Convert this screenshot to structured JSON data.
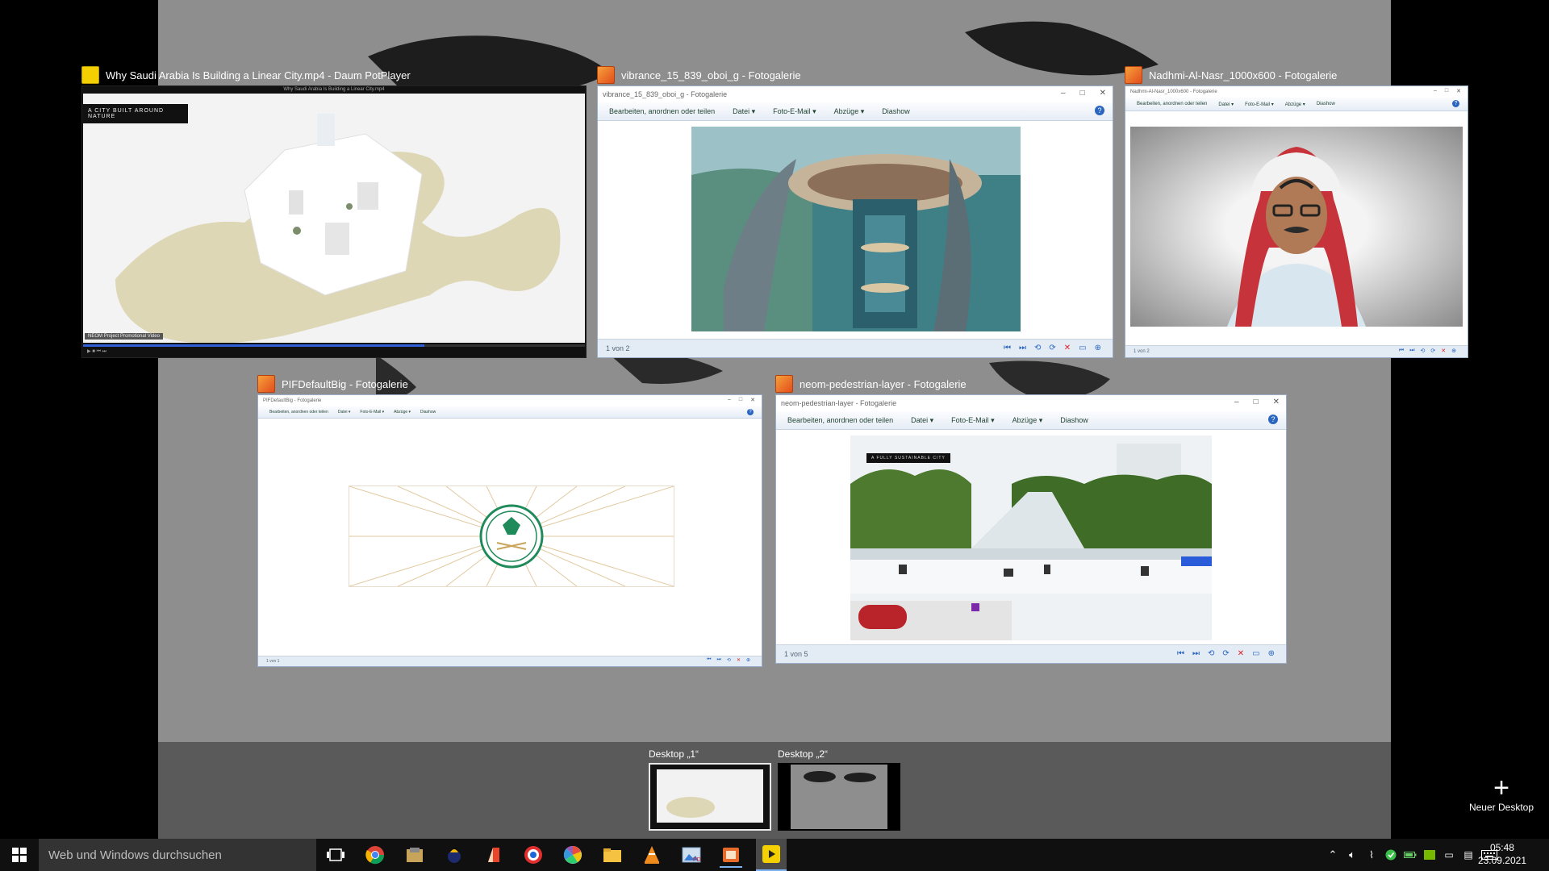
{
  "windows": [
    {
      "title": "Why Saudi Arabia Is Building a Linear City.mp4 - Daum PotPlayer",
      "app_icon": "potplayer-icon",
      "inner_title": "Why Saudi Arabia Is Building a Linear City.mp4",
      "overlay_caption": "A CITY BUILT AROUND NATURE",
      "corner_text": "NEOM Project Promotional Video"
    },
    {
      "title": "vibrance_15_839_oboi_g - Fotogalerie",
      "app_icon": "photo-gallery-icon",
      "inner_title": "vibrance_15_839_oboi_g - Fotogalerie",
      "menu": [
        "Bearbeiten, anordnen oder teilen",
        "Datei ▾",
        "Foto-E-Mail ▾",
        "Abzüge ▾",
        "Diashow"
      ],
      "status": "1 von 2"
    },
    {
      "title": "Nadhmi-Al-Nasr_1000x600 - Fotogalerie",
      "app_icon": "photo-gallery-icon",
      "inner_title": "Nadhmi-Al-Nasr_1000x600 - Fotogalerie",
      "menu": [
        "Bearbeiten, anordnen oder teilen",
        "Datei ▾",
        "Foto-E-Mail ▾",
        "Abzüge ▾",
        "Diashow"
      ],
      "status": "1 von 2"
    },
    {
      "title": "PIFDefaultBig - Fotogalerie",
      "app_icon": "photo-gallery-icon",
      "inner_title": "PIFDefaultBig - Fotogalerie",
      "menu": [
        "Bearbeiten, anordnen oder teilen",
        "Datei ▾",
        "Foto-E-Mail ▾",
        "Abzüge ▾",
        "Diashow"
      ],
      "status": "1 von 1"
    },
    {
      "title": "neom-pedestrian-layer - Fotogalerie",
      "app_icon": "photo-gallery-icon",
      "inner_title": "neom-pedestrian-layer - Fotogalerie",
      "menu": [
        "Bearbeiten, anordnen oder teilen",
        "Datei ▾",
        "Foto-E-Mail ▾",
        "Abzüge ▾",
        "Diashow"
      ],
      "status": "1 von 5",
      "photo_caption": "A FULLY SUSTAINABLE CITY"
    }
  ],
  "desktops": [
    {
      "label": "Desktop „1“",
      "active": true
    },
    {
      "label": "Desktop „2“",
      "active": false
    }
  ],
  "new_desktop_label": "Neuer Desktop",
  "taskbar": {
    "search_placeholder": "Web und Windows durchsuchen",
    "icons": [
      "task-view-icon",
      "chrome-icon",
      "file-archive-icon",
      "app-icon",
      "acrobat-icon",
      "opera-icon",
      "picasa-icon",
      "file-explorer-icon",
      "vlc-icon",
      "photo-viewer-icon",
      "photo-gallery-taskbar-icon",
      "potplayer-taskbar-icon"
    ],
    "time": "05:48",
    "date": "23.09.2021"
  },
  "colors": {
    "wallpaper": "#8e8e8e",
    "desktop_bar": "#5a5a5a",
    "taskbar": "#101010",
    "accent": "#2a66c0"
  }
}
